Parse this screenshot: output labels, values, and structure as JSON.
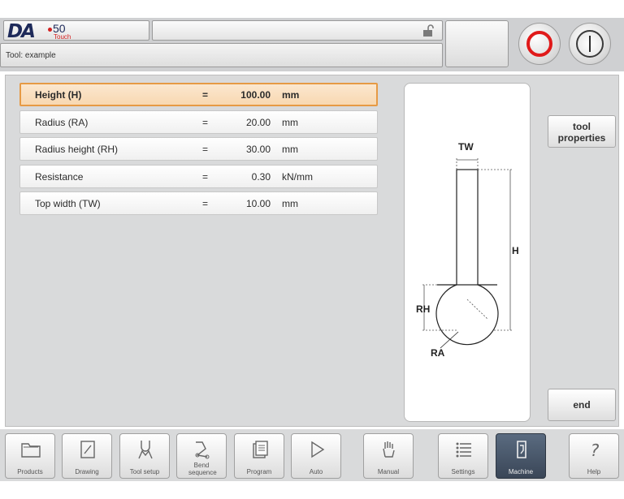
{
  "header": {
    "logo_brand": "DA",
    "logo_model": "50",
    "logo_variant": "Touch",
    "status_text": "",
    "title": "Tool: example"
  },
  "parameters": [
    {
      "label": "Height (H)",
      "eq": "=",
      "value": "100.00",
      "unit": "mm",
      "selected": true
    },
    {
      "label": "Radius (RA)",
      "eq": "=",
      "value": "20.00",
      "unit": "mm",
      "selected": false
    },
    {
      "label": "Radius height (RH)",
      "eq": "=",
      "value": "30.00",
      "unit": "mm",
      "selected": false
    },
    {
      "label": "Resistance",
      "eq": "=",
      "value": "0.30",
      "unit": "kN/mm",
      "selected": false
    },
    {
      "label": "Top width (TW)",
      "eq": "=",
      "value": "10.00",
      "unit": "mm",
      "selected": false
    }
  ],
  "drawing": {
    "label_tw": "TW",
    "label_h": "H",
    "label_rh": "RH",
    "label_ra": "RA"
  },
  "side_buttons": {
    "tool_properties_line1": "tool",
    "tool_properties_line2": "properties",
    "end": "end"
  },
  "nav": [
    {
      "label": "Products",
      "icon": "folder-icon"
    },
    {
      "label": "Drawing",
      "icon": "drawing-icon"
    },
    {
      "label": "Tool setup",
      "icon": "tool-setup-icon"
    },
    {
      "label": "Bend sequence",
      "icon": "bend-sequence-icon"
    },
    {
      "label": "Program",
      "icon": "program-icon"
    },
    {
      "label": "Auto",
      "icon": "play-icon"
    },
    {
      "label": "Manual",
      "icon": "hand-icon"
    },
    {
      "label": "Settings",
      "icon": "settings-icon"
    },
    {
      "label": "Machine",
      "icon": "machine-icon",
      "active": true
    },
    {
      "label": "Help",
      "icon": "help-icon"
    }
  ],
  "colors": {
    "accent_selected": "#e69a45",
    "stop_red": "#e01a1a",
    "active_nav": "#3a4657"
  }
}
